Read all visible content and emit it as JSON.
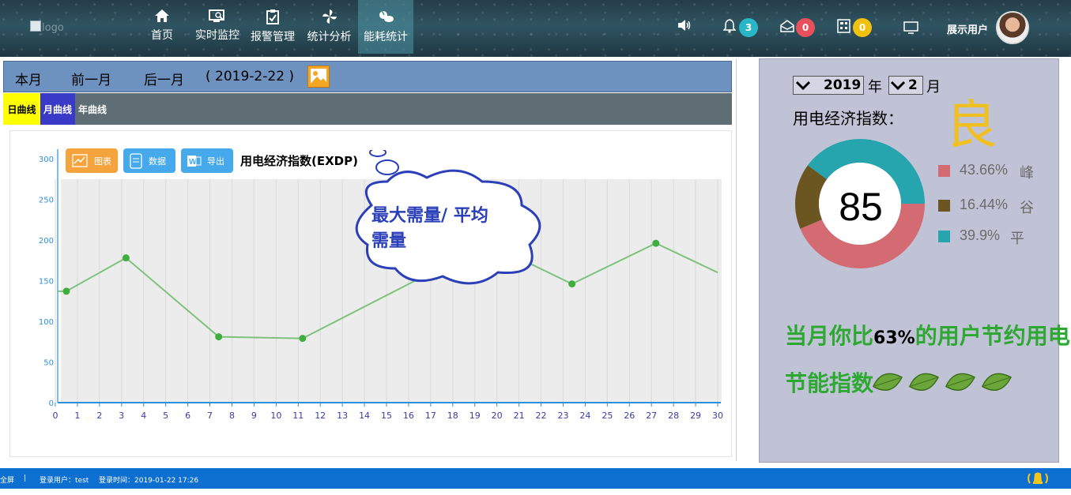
{
  "header": {
    "logo_alt": "logo",
    "nav": [
      {
        "label": "首页",
        "icon": "home-icon"
      },
      {
        "label": "实时监控",
        "icon": "monitor-icon"
      },
      {
        "label": "报警管理",
        "icon": "clipboard-icon"
      },
      {
        "label": "统计分析",
        "icon": "pinwheel-icon"
      },
      {
        "label": "能耗统计",
        "icon": "energy-icon"
      }
    ],
    "notifications": {
      "bell": "3",
      "home": "0",
      "calc": "0"
    },
    "username": "展示用户"
  },
  "toolbar": {
    "this_month": "本月",
    "prev_month": "前一月",
    "next_month": "后一月",
    "date": "( 2019-2-22 )"
  },
  "tabs": {
    "day": "日曲线",
    "month": "月曲线",
    "year": "年曲线"
  },
  "chips": {
    "chart": "图表",
    "data": "数据",
    "export": "导出"
  },
  "colors": {
    "nav_active": "#4f97a5",
    "toolbar": "#6e92bf",
    "tab_day": "#ffff00",
    "tab_month": "#3a3ac8",
    "chart_line": "#7ec27e",
    "marker": "#3fae3f",
    "cloud": "#2a3fb8",
    "donut_peak": "#d46a72",
    "donut_valley": "#6b5520",
    "donut_flat": "#26a5ae",
    "good": "#f0c020",
    "green_text": "#2ea832",
    "status": "#0d6fd0"
  },
  "chart_data": {
    "type": "line",
    "title": "用电经济指数(EXDP)",
    "x": [
      0,
      1,
      2,
      3,
      4,
      5,
      6,
      7,
      8,
      9,
      10,
      11,
      12,
      13,
      14,
      15,
      16,
      17,
      18,
      19,
      20,
      21,
      22,
      23,
      24,
      25,
      26,
      27,
      28,
      29,
      30
    ],
    "y_points": [
      {
        "x": 0.5,
        "y": 137
      },
      {
        "x": 3.2,
        "y": 178
      },
      {
        "x": 7.4,
        "y": 81
      },
      {
        "x": 11.2,
        "y": 79
      },
      {
        "x": 19.6,
        "y": 196
      },
      {
        "x": 23.4,
        "y": 146
      },
      {
        "x": 27.2,
        "y": 196
      },
      {
        "x": 30,
        "y": 160
      }
    ],
    "y_ticks": [
      0,
      50,
      100,
      150,
      200,
      250,
      300
    ],
    "ylim": [
      0,
      300
    ],
    "xlim": [
      0,
      30
    ],
    "annotation": "最大需量/ 平均需量"
  },
  "right": {
    "year": "2019",
    "year_unit": "年",
    "month": "2",
    "month_unit": "月",
    "index_label": "用电经济指数：",
    "grade": "良",
    "score": "85",
    "legend": [
      {
        "pct": "43.66%",
        "name": "峰",
        "value": 43.66
      },
      {
        "pct": "16.44%",
        "name": "谷",
        "value": 16.44
      },
      {
        "pct": "39.9%",
        "name": "平",
        "value": 39.9
      }
    ],
    "saving_pre": "当月你比",
    "saving_pct": "63%",
    "saving_post": "的用户节约用电",
    "energy_label": "节能指数",
    "leaf_count": 4
  },
  "status": {
    "left": "全屏",
    "sep": "|",
    "user": "登录用户：test",
    "time": "登录时间：2019-01-22 17:26"
  }
}
